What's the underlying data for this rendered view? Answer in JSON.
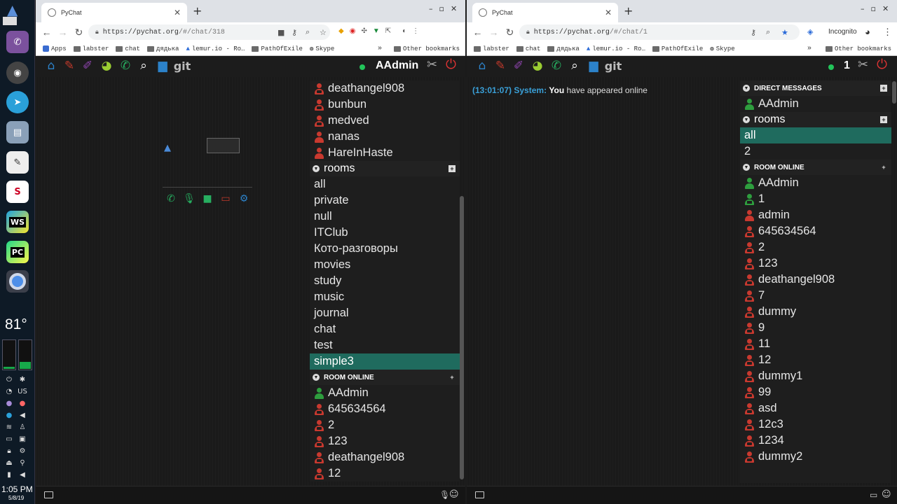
{
  "dock": {
    "temperature": "81°",
    "clock_time": "1:05 PM",
    "clock_date": "5/8/19",
    "keyboard_layout": "US",
    "apps": [
      "launcher-icon",
      "viber-icon",
      "obs-icon",
      "telegram-icon",
      "file-manager-icon",
      "text-editor-icon",
      "slack-icon",
      "webstorm-icon",
      "pycharm-icon",
      "chromium-icon"
    ],
    "app_letters": {
      "slack": "S",
      "webstorm": "WS",
      "pycharm": "PC"
    }
  },
  "left_window": {
    "tab_title": "PyChat",
    "url_host": "https://pychat.org",
    "url_path": "/#/chat/318",
    "bookmarks": [
      "Apps",
      "labster",
      "chat",
      "дядька",
      "lemur.io - Ro…",
      "PathOfExile",
      "Skype"
    ],
    "other_bookmarks": "Other bookmarks",
    "toolbar": {
      "git_label": "git",
      "username": "AAdmin"
    },
    "direct_users": [
      {
        "name": "deathangel908",
        "icon": "red-offline"
      },
      {
        "name": "bunbun",
        "icon": "red-offline"
      },
      {
        "name": "medved",
        "icon": "red-offline"
      },
      {
        "name": "nanas",
        "icon": "red"
      },
      {
        "name": "HareInHaste",
        "icon": "red"
      }
    ],
    "rooms_header": "rooms",
    "rooms": [
      "all",
      "private",
      "null",
      "ITClub",
      "Кото-разговоры",
      "movies",
      "study",
      "music",
      "journal",
      "chat",
      "test",
      "simple3"
    ],
    "selected_room": "simple3",
    "room_online_header": "ROOM ONLINE",
    "room_online": [
      {
        "name": "AAdmin",
        "icon": "green"
      },
      {
        "name": "645634564",
        "icon": "red-offline"
      },
      {
        "name": "2",
        "icon": "red-offline"
      },
      {
        "name": "123",
        "icon": "red-offline"
      },
      {
        "name": "deathangel908",
        "icon": "red-offline"
      },
      {
        "name": "12",
        "icon": "red-offline"
      }
    ]
  },
  "right_window": {
    "tab_title": "PyChat",
    "url_host": "https://pychat.org",
    "url_path": "/#/chat/1",
    "incognito_label": "Incognito",
    "bookmarks": [
      "labster",
      "chat",
      "дядька",
      "lemur.io - Ro…",
      "PathOfExile",
      "Skype"
    ],
    "other_bookmarks": "Other bookmarks",
    "toolbar": {
      "git_label": "git",
      "username": "1"
    },
    "message": {
      "time": "(13:01:07)",
      "sender": "System:",
      "you": "You",
      "text": " have appeared online"
    },
    "direct_header": "DIRECT MESSAGES",
    "direct_users": [
      {
        "name": "AAdmin",
        "icon": "green"
      }
    ],
    "rooms_header": "rooms",
    "rooms": [
      "all",
      "2"
    ],
    "selected_room": "all",
    "room_online_header": "ROOM ONLINE",
    "room_online": [
      {
        "name": "AAdmin",
        "icon": "green"
      },
      {
        "name": "1",
        "icon": "green-offline"
      },
      {
        "name": "admin",
        "icon": "red"
      },
      {
        "name": "645634564",
        "icon": "red-offline"
      },
      {
        "name": "2",
        "icon": "red-offline"
      },
      {
        "name": "123",
        "icon": "red-offline"
      },
      {
        "name": "deathangel908",
        "icon": "red-offline"
      },
      {
        "name": "7",
        "icon": "red-offline"
      },
      {
        "name": "dummy",
        "icon": "red-offline"
      },
      {
        "name": "9",
        "icon": "red-offline"
      },
      {
        "name": "11",
        "icon": "red-offline"
      },
      {
        "name": "12",
        "icon": "red-offline"
      },
      {
        "name": "dummy1",
        "icon": "red-offline"
      },
      {
        "name": "99",
        "icon": "red-offline"
      },
      {
        "name": "asd",
        "icon": "red-offline"
      },
      {
        "name": "12c3",
        "icon": "red-offline"
      },
      {
        "name": "1234",
        "icon": "red-offline"
      },
      {
        "name": "dummy2",
        "icon": "red-offline"
      }
    ]
  },
  "colors": {
    "selected_room": "#1f6b5e",
    "online_green": "#2e9e3e",
    "offline_red": "#c8392f",
    "accent_blue": "#2c82c9"
  }
}
